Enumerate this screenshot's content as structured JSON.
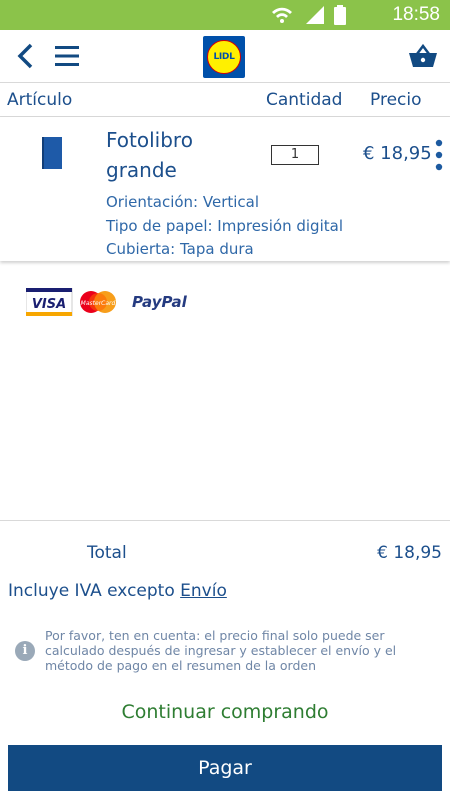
{
  "status": {
    "time": "18:58"
  },
  "header": {
    "logo_text": "LIDL"
  },
  "columns": {
    "article": "Artículo",
    "quantity": "Cantidad",
    "price": "Precio"
  },
  "item": {
    "name": "Fotolibro grande",
    "quantity": "1",
    "price": "€ 18,95",
    "attributes": [
      "Orientación: Vertical",
      "Tipo de papel: Impresión digital",
      "Cubierta: Tapa dura"
    ]
  },
  "payments": {
    "visa": "VISA",
    "mastercard": "MasterCard",
    "paypal": "PayPal"
  },
  "summary": {
    "total_label": "Total",
    "total_value": "€ 18,95",
    "vat_text": "Incluye IVA excepto ",
    "shipping_link": "Envío",
    "note": "Por favor, ten en cuenta: el precio final solo puede ser calculado después de ingresar y establecer el envío y el método de pago en el resumen de la orden",
    "info_icon_glyph": "i"
  },
  "actions": {
    "continue": "Continuar comprando",
    "pay": "Pagar"
  },
  "colors": {
    "status_bar": "#8bc34a",
    "primary": "#124a82",
    "text": "#1c4f8c",
    "continue": "#2e7d32"
  }
}
